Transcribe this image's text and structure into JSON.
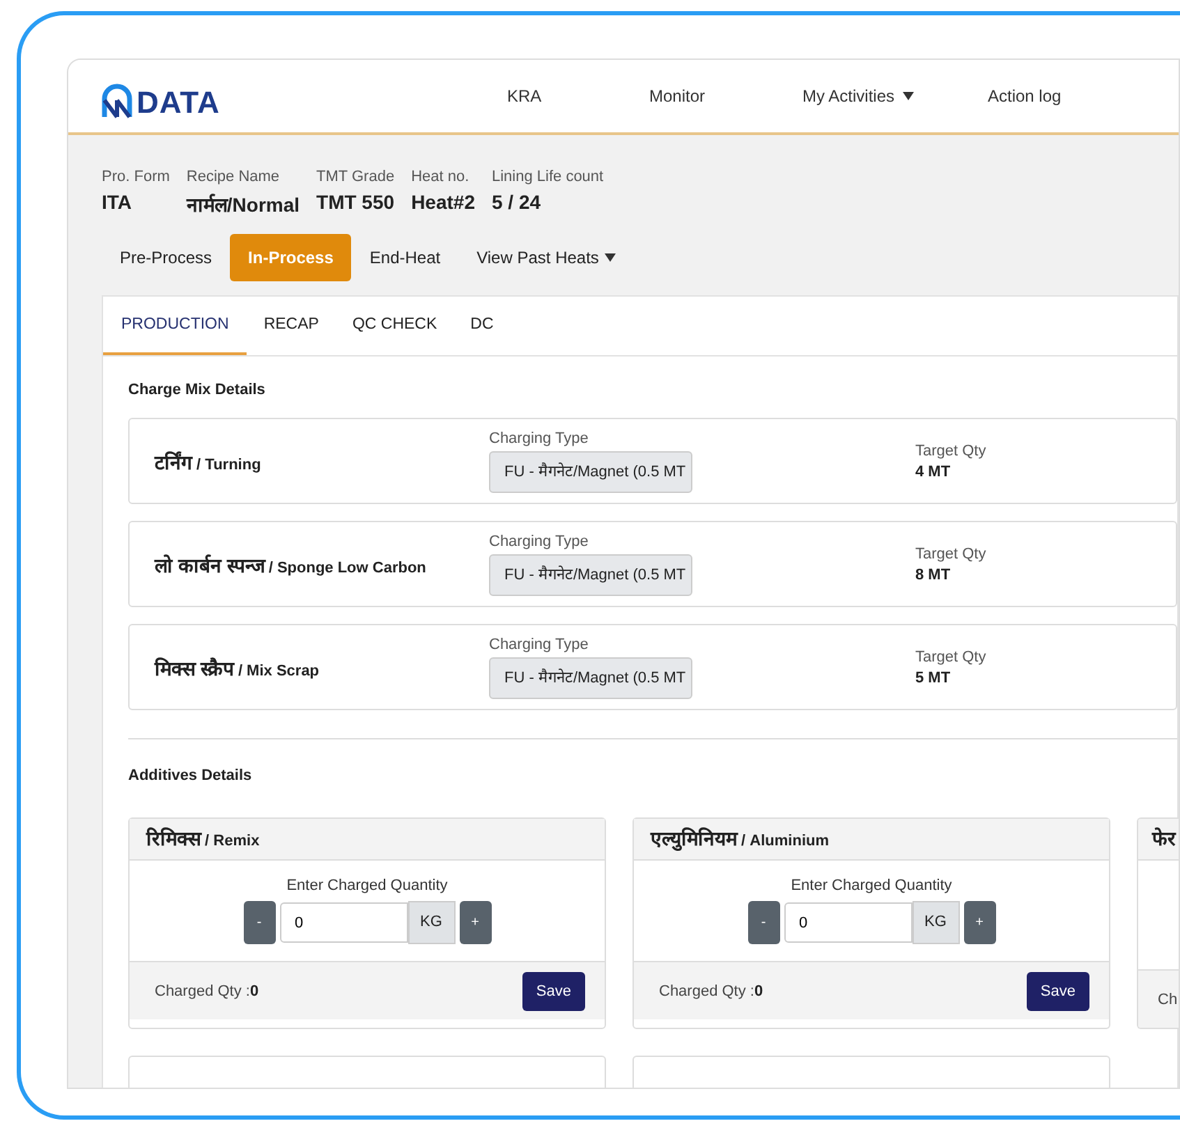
{
  "header": {
    "logo": "DATA",
    "nav": [
      {
        "label": "KRA",
        "dropdown": false
      },
      {
        "label": "Monitor",
        "dropdown": false
      },
      {
        "label": "My Activities",
        "dropdown": true
      },
      {
        "label": "Action log",
        "dropdown": false
      }
    ]
  },
  "info": [
    {
      "label": "Pro. Form",
      "value": "ITA"
    },
    {
      "label": "Recipe Name",
      "value": "नार्मल/Normal"
    },
    {
      "label": "TMT Grade",
      "value": "TMT 550"
    },
    {
      "label": "Heat no.",
      "value": "Heat#2"
    },
    {
      "label": "Lining Life count",
      "value": "5 / 24"
    }
  ],
  "stage_tabs": [
    {
      "label": "Pre-Process",
      "selected": false,
      "dropdown": false
    },
    {
      "label": "In-Process",
      "selected": true,
      "dropdown": false
    },
    {
      "label": "End-Heat",
      "selected": false,
      "dropdown": false
    },
    {
      "label": "View Past Heats",
      "selected": false,
      "dropdown": true
    }
  ],
  "tabs": [
    {
      "label": "PRODUCTION",
      "selected": true
    },
    {
      "label": "RECAP",
      "selected": false
    },
    {
      "label": "QC CHECK",
      "selected": false
    },
    {
      "label": "DC",
      "selected": false
    }
  ],
  "charge_mix": {
    "title": "Charge Mix Details",
    "rows": [
      {
        "name_hi": "टर्निंग",
        "name_en": "/ Turning",
        "type_label": "Charging Type",
        "type_value": "FU - मैगनेट/Magnet (0.5 MT",
        "qty_label": "Target Qty",
        "qty": "4 MT"
      },
      {
        "name_hi": "लो कार्बन स्पन्ज",
        "name_en": "/ Sponge Low Carbon",
        "type_label": "Charging Type",
        "type_value": "FU - मैगनेट/Magnet (0.5 MT",
        "qty_label": "Target Qty",
        "qty": "8 MT"
      },
      {
        "name_hi": "मिक्स स्क्रैप",
        "name_en": "/ Mix Scrap",
        "type_label": "Charging Type",
        "type_value": "FU - मैगनेट/Magnet (0.5 MT",
        "qty_label": "Target Qty",
        "qty": "5 MT"
      }
    ]
  },
  "additives": {
    "title": "Additives Details",
    "cards": [
      {
        "kind": "full",
        "name_hi": "रिमिक्स",
        "name_en": "/ Remix",
        "prompt": "Enter Charged Quantity",
        "minus": "-",
        "value": "0",
        "unit": "KG",
        "plus": "+",
        "charged_label": "Charged Qty :",
        "charged": "0",
        "save": "Save"
      },
      {
        "kind": "full",
        "name_hi": "एल्युमिनियम",
        "name_en": "/ Aluminium",
        "prompt": "Enter Charged Quantity",
        "minus": "-",
        "value": "0",
        "unit": "KG",
        "plus": "+",
        "charged_label": "Charged Qty :",
        "charged": "0",
        "save": "Save"
      },
      {
        "kind": "edge",
        "name_hi": "फेर",
        "charged_label": "Ch"
      },
      {
        "kind": "stub"
      },
      {
        "kind": "stub"
      }
    ]
  }
}
